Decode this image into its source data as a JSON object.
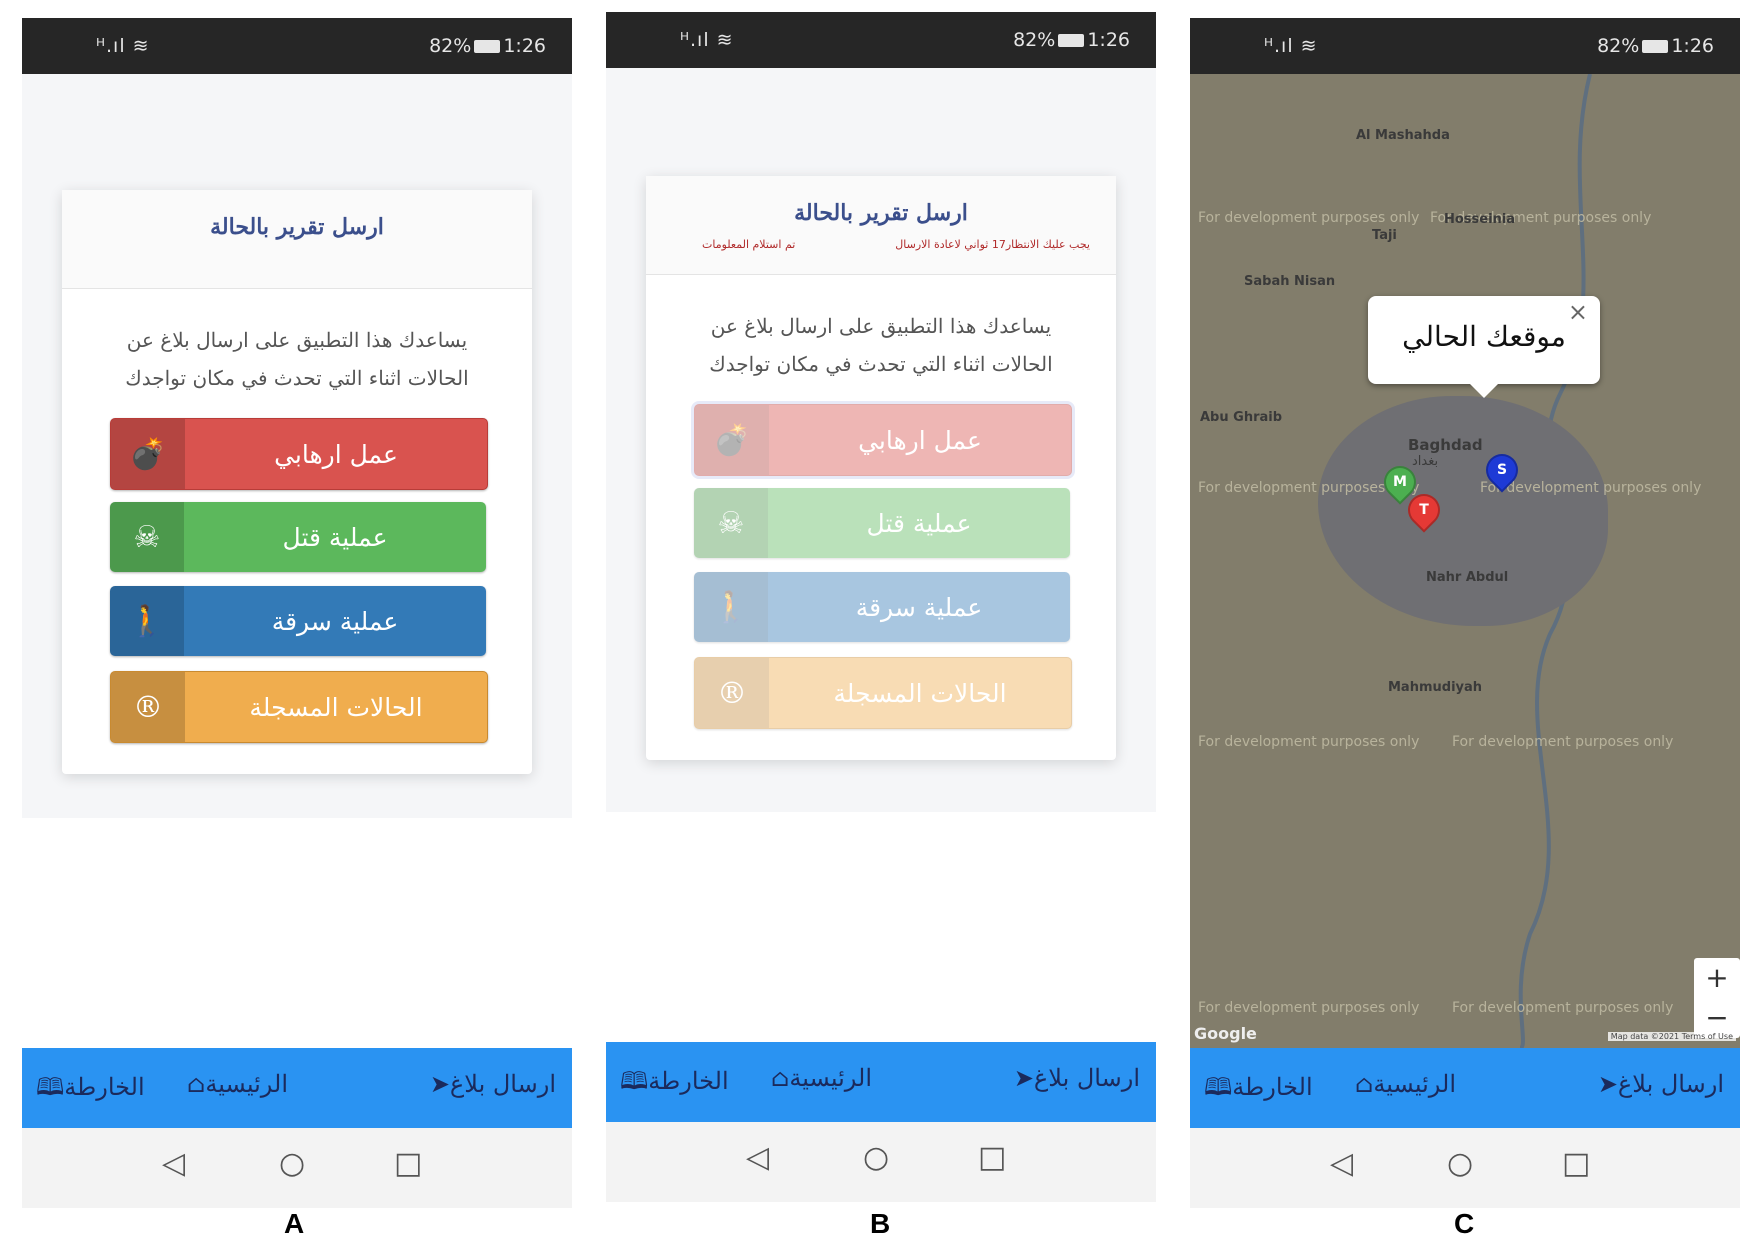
{
  "status": {
    "signal": "ᴴ.ıl ≋",
    "battery": "82%",
    "time": "1:26"
  },
  "card": {
    "title": "ارسل تقرير بالحالة",
    "warning_1": "يجب عليك الانتظار17 ثواني لاعادة الارسال",
    "warning_2": "تم استلام المعلومات",
    "description": "يساعدك هذا التطبيق على ارسال بلاغ عن الحالات اثناء التي تحدث في مكان تواجدك"
  },
  "buttons": [
    {
      "label": "عمل ارهابي",
      "icon": "bomb-icon",
      "glyph": "💣",
      "color": "#d9534f"
    },
    {
      "label": "عملية قتل",
      "icon": "skull-crossbones-icon",
      "glyph": "☠",
      "color": "#5cb85c"
    },
    {
      "label": "عملية سرقة",
      "icon": "walking-person-icon",
      "glyph": "🚶",
      "color": "#337ab7"
    },
    {
      "label": "الحالات المسجلة",
      "icon": "registered-icon",
      "glyph": "®",
      "color": "#f0ad4e"
    }
  ],
  "nav": {
    "map": "الخارطة",
    "home": "الرئيسية",
    "send": "ارسال بلاغ",
    "map_glyph": "🕮",
    "home_glyph": "⌂",
    "send_glyph": "➤"
  },
  "sysnav": {
    "back": "◁",
    "home": "○",
    "recent": "□"
  },
  "map": {
    "popup_text": "موقعك الحالي",
    "close": "×",
    "city": "Baghdad",
    "city_ar": "بغداد",
    "watermark": "For development purposes only",
    "places": [
      "Taji",
      "Hosseinia",
      "Al Mashahda",
      "Sabah Nisan",
      "Mahmudiyah",
      "Abu Ghraib",
      "Nahr Abdul"
    ],
    "pins": [
      {
        "letter": "M",
        "color": "#4caf50"
      },
      {
        "letter": "T",
        "color": "#e53935"
      },
      {
        "letter": "S",
        "color": "#1e3ad6"
      }
    ],
    "zoom_in": "+",
    "zoom_out": "−",
    "attribution": "Map data ©2021  Terms of Use",
    "google": "Google"
  },
  "panels": [
    "A",
    "B",
    "C"
  ]
}
